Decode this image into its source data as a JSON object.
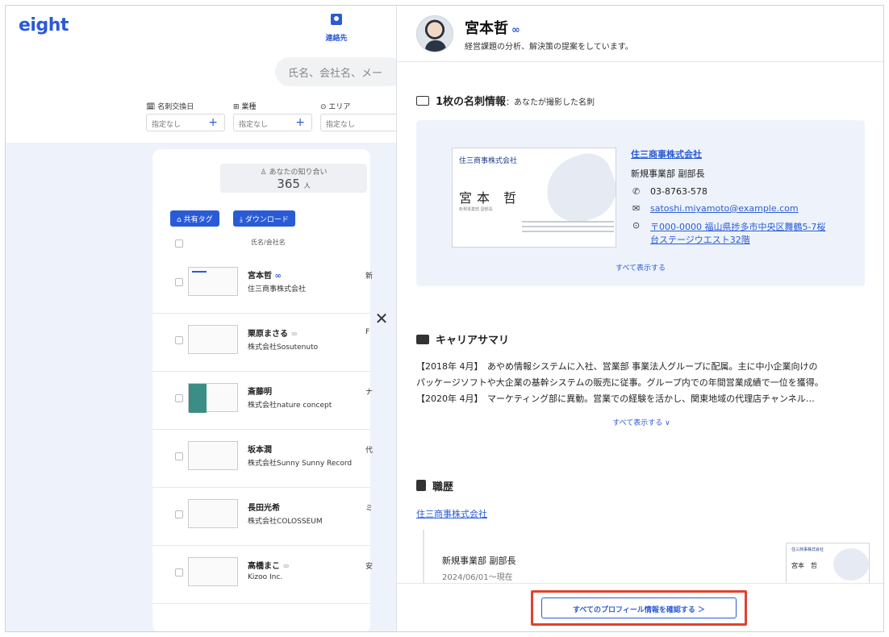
{
  "app": {
    "logo": "eight",
    "nav_contacts": "連絡先",
    "search_placeholder": "氏名、会社名、メー"
  },
  "filters": [
    {
      "label": "名刺交換日",
      "icon": "calendar-icon",
      "value": "指定なし"
    },
    {
      "label": "業種",
      "icon": "building-icon",
      "value": "指定なし"
    },
    {
      "label": "エリア",
      "icon": "pin-icon",
      "value": "指定なし"
    }
  ],
  "list": {
    "acquaintance_label": "あなたの知り合い",
    "acquaintance_count": "365",
    "acquaintance_unit": "人",
    "share_tag_btn": "共有タグ",
    "download_btn": "ダウンロード",
    "col_name": "氏名/会社名",
    "rows": [
      {
        "name": "宮本哲",
        "badge": "∞",
        "company": "住三商事株式会社",
        "side": "新\n副"
      },
      {
        "name": "栗原まさる",
        "badge": "∞",
        "company": "株式会社Sosutenuto",
        "side": "F"
      },
      {
        "name": "斎藤明",
        "badge": "",
        "company": "株式会社nature concept",
        "side": "ナ"
      },
      {
        "name": "坂本潤",
        "badge": "",
        "company": "株式会社Sunny Sunny Record",
        "side": "代"
      },
      {
        "name": "長田光希",
        "badge": "",
        "company": "株式会社COLOSSEUM",
        "side": "ミ"
      },
      {
        "name": "高橋まこ",
        "badge": "∞",
        "company": "Kizoo Inc.",
        "side": "安"
      }
    ]
  },
  "profile": {
    "name": "宮本哲",
    "badge": "∞",
    "bio": "経営課題の分析、解決策の提案をしています。"
  },
  "meishi": {
    "title": "1枚の名刺情報",
    "subtitle": "：あなたが撮影した名刺",
    "card_company": "住三商事株式会社",
    "card_name": "宮本 哲",
    "card_sub": "新規事業部 副部長",
    "company": "住三商事株式会社",
    "dept": "新規事業部 副部長",
    "phone": "03-8763-578",
    "email": "satoshi.miyamoto@example.com",
    "address_line1": "〒000-0000 福山県捗多市中央区舞鶴5-7桜",
    "address_line2": "台ステージウエスト32階",
    "show_all": "すべて表示する"
  },
  "career": {
    "title": "キャリアサマリ",
    "lines": [
      "【2018年 4月】　あやめ情報システムに入社、営業部 事業法人グループに配属。主に中小企業向けの",
      "パッケージソフトや大企業の基幹システムの販売に従事。グループ内での年間営業成績で一位を獲得。",
      "【2020年 4月】　マーケティング部に異動。営業での経験を活かし、関東地域の代理店チャンネル…"
    ],
    "show_all": "すべて表示する ∨"
  },
  "history": {
    "title": "職歴",
    "company": "住三商事株式会社",
    "role": "新規事業部 副部長",
    "period": "2024/06/01～現在",
    "card_company": "住三商事株式会社",
    "card_name": "宮本　哲"
  },
  "footer": {
    "confirm_btn": "すべてのプロフィール情報を確認する ＞"
  },
  "colors": {
    "accent": "#2a5bd7",
    "highlight": "#e0412f",
    "panel_bg": "#eef2fa"
  }
}
